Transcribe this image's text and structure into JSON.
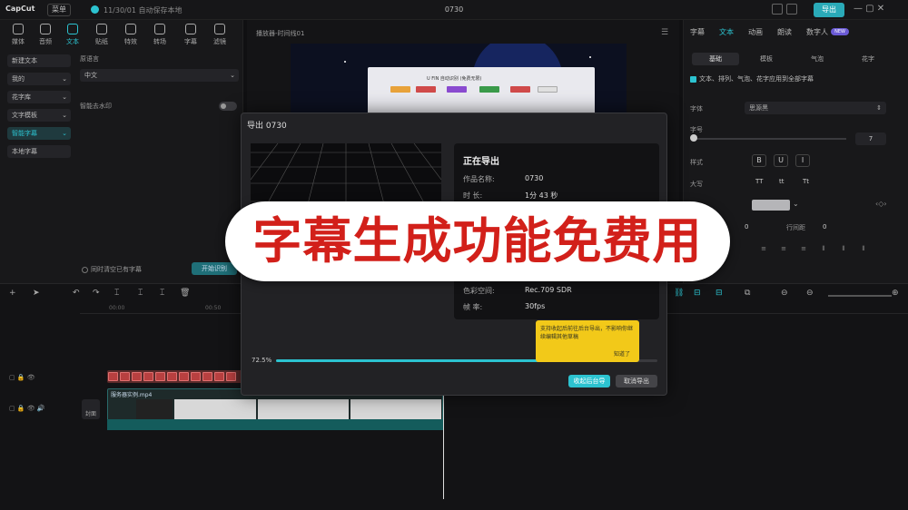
{
  "topbar": {
    "logo": "CapCut",
    "menu_label": "菜单",
    "autosave": "11/30/01 自动保存本地",
    "project_title": "0730",
    "export_label": "导出"
  },
  "tools": [
    {
      "label": "媒体"
    },
    {
      "label": "音频"
    },
    {
      "label": "文本"
    },
    {
      "label": "贴纸"
    },
    {
      "label": "特效"
    },
    {
      "label": "转场"
    },
    {
      "label": "字幕"
    },
    {
      "label": "滤镜"
    }
  ],
  "left_nav": [
    {
      "label": "新建文本"
    },
    {
      "label": "我的"
    },
    {
      "label": "花字库"
    },
    {
      "label": "文字模板"
    },
    {
      "label": "智能字幕"
    },
    {
      "label": "本地字幕"
    }
  ],
  "left_content": {
    "lang_label": "原语言",
    "lang_value": "中文",
    "bilingual_label": "智能去水印",
    "clear_label": "同时清空已有字幕",
    "start_label": "开始识别"
  },
  "player": {
    "title": "播放器-时间线01",
    "doc_title": "U FIN 自动识别 (免费无限)"
  },
  "right_panel": {
    "tabs": [
      "字幕",
      "文本",
      "动画",
      "朗读",
      "数字人"
    ],
    "dh_badge": "NEW",
    "subtabs": [
      "基础",
      "模板",
      "气泡",
      "花字"
    ],
    "apply_all": "文本、排列、气泡、花字应用到全部字幕",
    "font_label": "字体",
    "font_value": "思源黑",
    "size_label": "字号",
    "size_value": "7",
    "style_label": "样式",
    "case_label": "大写",
    "style_buttons": [
      "B",
      "U",
      "I"
    ],
    "case_buttons": [
      "TT",
      "tt",
      "Tt"
    ],
    "spacing_label": "行间距",
    "spacing_value_1": "0",
    "spacing_value_2": "0"
  },
  "timeline": {
    "ticks": [
      "00:00",
      "00:50"
    ],
    "video_clip_name": "服务器实例.mp4",
    "cover_label": "封面",
    "sub_clip_text": "字幕"
  },
  "dialog": {
    "title": "导出 0730",
    "heading": "正在导出",
    "rows": [
      {
        "key": "作品名称:",
        "value": "0730"
      },
      {
        "key": "时 长:",
        "value": "1分 43 秒"
      },
      {
        "key": "色彩空间:",
        "value": "Rec.709 SDR"
      },
      {
        "key": "帧 率:",
        "value": "30fps"
      }
    ],
    "progress_text": "72.5%",
    "progress": 0.725,
    "tooltip_text": "支持收起后前往后台导出，不影响你继续编辑其他草稿",
    "tooltip_ok": "知道了",
    "bg_export_label": "收起后台导",
    "cancel_label": "取消导出"
  },
  "banner": {
    "text": "字幕生成功能免费用"
  },
  "colors": {
    "accent": "#2cc3d0",
    "banner_text": "#d2201a",
    "tooltip": "#f2c919"
  }
}
